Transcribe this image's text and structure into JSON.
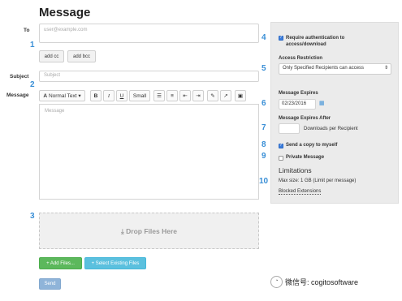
{
  "page": {
    "title": "Message"
  },
  "form": {
    "to_label": "To",
    "to_placeholder": "user@example.com",
    "add_cc": "add cc",
    "add_bcc": "add bcc",
    "subject_label": "Subject",
    "subject_placeholder": "Subject",
    "message_label": "Message",
    "message_placeholder": "Message"
  },
  "toolbar": {
    "normal_text": "Normal Text",
    "bold": "B",
    "italic": "I",
    "underline": "U",
    "small": "Small"
  },
  "dropzone": {
    "text": "Drop Files Here",
    "icon": "download-icon"
  },
  "buttons": {
    "add_files": "Add Files...",
    "select_existing": "Select Existing Files",
    "send": "Send"
  },
  "sidebar": {
    "require_auth": "Require authentication to access/download",
    "require_auth_checked": true,
    "access_restriction_label": "Access Restriction",
    "access_restriction_value": "Only Specified Recipients can access",
    "expires_label": "Message Expires",
    "expires_value": "02/23/2016",
    "expires_after_label": "Message Expires After",
    "downloads_suffix": "Downloads per Recipient",
    "send_copy": "Send a copy to myself",
    "send_copy_checked": true,
    "private_message": "Private Message",
    "private_message_checked": false,
    "limitations_title": "Limitations",
    "max_size": "Max size: 1 GB (Limit per message)",
    "blocked_extensions": "Blocked Extensions"
  },
  "callouts": [
    "1",
    "2",
    "3",
    "4",
    "5",
    "6",
    "7",
    "8",
    "9",
    "10"
  ],
  "watermark": {
    "text": "微信号: cogitosoftware"
  },
  "colors": {
    "accent": "#3a8fd6",
    "green": "#5cb85c",
    "info": "#5bc0de"
  }
}
